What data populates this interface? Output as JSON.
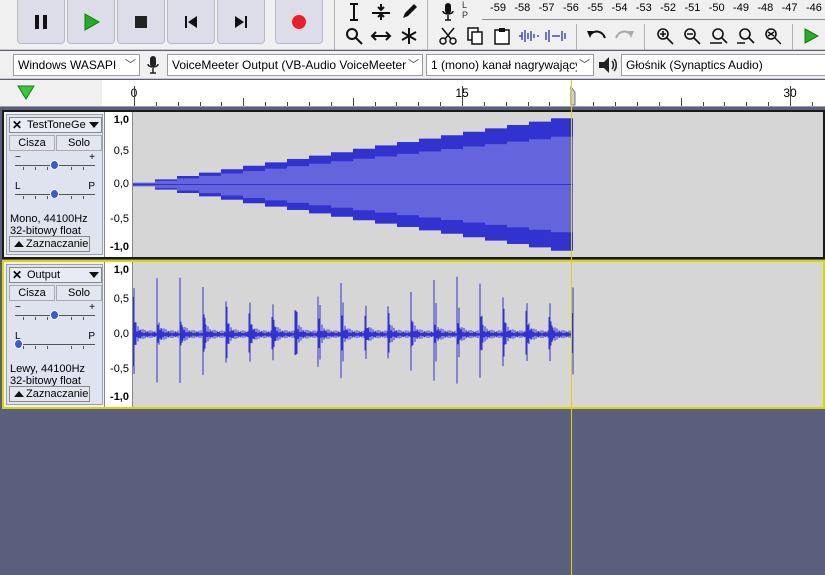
{
  "transport": {
    "pause": "pause-button",
    "play": "play-button",
    "stop": "stop-button",
    "skip_start": "skip-to-start-button",
    "skip_end": "skip-to-end-button",
    "record": "record-button"
  },
  "meter": {
    "lr_label": "L\nP",
    "ticks": [
      "-59",
      "-58",
      "-57",
      "-56",
      "-55",
      "-54",
      "-53",
      "-52",
      "-51",
      "-50",
      "-49",
      "-48",
      "-47",
      "-46"
    ]
  },
  "devices": {
    "host": "Windows WASAPI",
    "input": "VoiceMeeter Output (VB-Audio VoiceMeeter",
    "channels": "1 (mono) kanał nagrywający",
    "output": "Głośnik (Synaptics Audio)"
  },
  "ruler": {
    "labels": [
      "0",
      "15",
      "30"
    ]
  },
  "tracks": [
    {
      "name": "TestToneGe",
      "mute": "Cisza",
      "solo": "Solo",
      "gain_minus": "−",
      "gain_plus": "+",
      "pan_left": "L",
      "pan_right": "P",
      "info_line1": "Mono, 44100Hz",
      "info_line2": "32-bitowy float",
      "select": "Zaznaczanie",
      "scale": [
        "1,0",
        "0,5",
        "0,0",
        "-0,5",
        "-1,0"
      ]
    },
    {
      "name": "Output",
      "mute": "Cisza",
      "solo": "Solo",
      "gain_minus": "−",
      "gain_plus": "+",
      "pan_left": "L",
      "pan_right": "P",
      "info_line1": "Lewy, 44100Hz",
      "info_line2": "32-bitowy float",
      "select": "Zaznaczanie",
      "scale": [
        "1,0",
        "0,5",
        "0,0",
        "-0,5",
        "-1,0"
      ]
    }
  ],
  "colors": {
    "waveform_outer": "#3232d0",
    "waveform_inner": "#6464dc",
    "track_bg": "#d6d6d6",
    "selection_border": "#d8d800",
    "empty_area": "#5b5e7c"
  }
}
